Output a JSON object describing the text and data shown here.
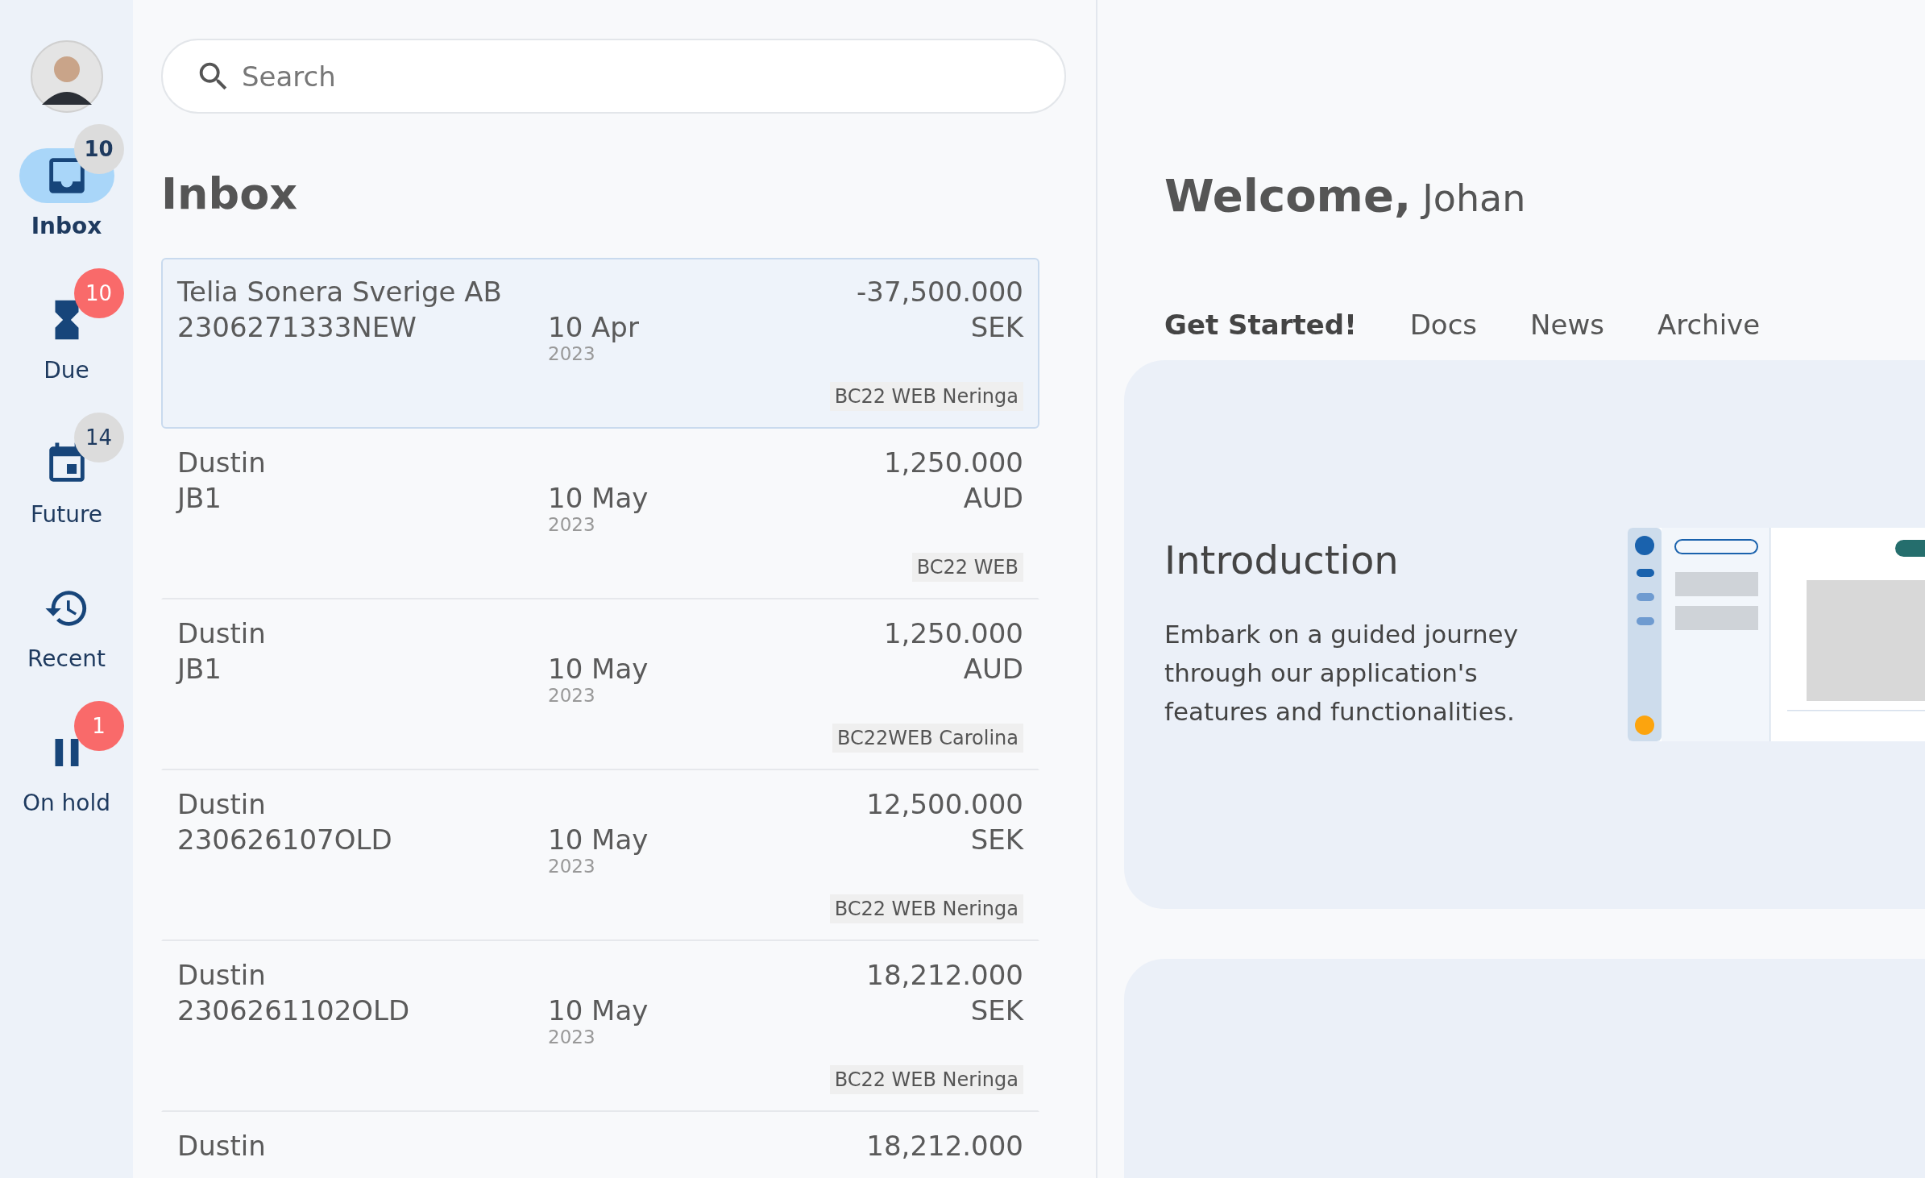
{
  "sidebar": {
    "items": [
      {
        "label": "Inbox",
        "selected": true,
        "badge": {
          "count": "10",
          "color": "#dcdcdc"
        }
      },
      {
        "label": "Due",
        "selected": false,
        "badge": {
          "count": "10",
          "color": "#f96a6a"
        }
      },
      {
        "label": "Future",
        "selected": false,
        "badge": {
          "count": "14",
          "color": "#dcdcdc"
        }
      },
      {
        "label": "Recent",
        "selected": false
      },
      {
        "label": "On hold",
        "selected": false,
        "badge": {
          "count": "1",
          "color": "#f96a6a"
        }
      }
    ]
  },
  "search": {
    "placeholder": "Search"
  },
  "inbox": {
    "title": "Inbox",
    "rows": [
      {
        "name": "Telia Sonera Sverige AB",
        "reference": "2306271333NEW",
        "date": "10 Apr",
        "year": "2023",
        "amount": "-37,500.000",
        "currency": "SEK",
        "tag": "BC22 WEB Neringa",
        "selected": true
      },
      {
        "name": "Dustin",
        "reference": "JB1",
        "date": "10 May",
        "year": "2023",
        "amount": "1,250.000",
        "currency": "AUD",
        "tag": "BC22 WEB",
        "selected": false
      },
      {
        "name": "Dustin",
        "reference": "JB1",
        "date": "10 May",
        "year": "2023",
        "amount": "1,250.000",
        "currency": "AUD",
        "tag": "BC22WEB Carolina",
        "selected": false
      },
      {
        "name": "Dustin",
        "reference": "230626107OLD",
        "date": "10 May",
        "year": "2023",
        "amount": "12,500.000",
        "currency": "SEK",
        "tag": "BC22 WEB Neringa",
        "selected": false
      },
      {
        "name": "Dustin",
        "reference": "2306261102OLD",
        "date": "10 May",
        "year": "2023",
        "amount": "18,212.000",
        "currency": "SEK",
        "tag": "BC22 WEB Neringa",
        "selected": false
      },
      {
        "name": "Dustin",
        "amount": "18,212.000",
        "selected": false
      }
    ]
  },
  "welcome": {
    "greeting": "Welcome,",
    "name": "Johan"
  },
  "tabs": [
    {
      "label": "Get Started!",
      "selected": true
    },
    {
      "label": "Docs",
      "selected": false
    },
    {
      "label": "News",
      "selected": false
    },
    {
      "label": "Archive",
      "selected": false
    }
  ],
  "intro": {
    "title": "Introduction",
    "text": "Embark on a guided journey through our application's features and functionalities."
  }
}
